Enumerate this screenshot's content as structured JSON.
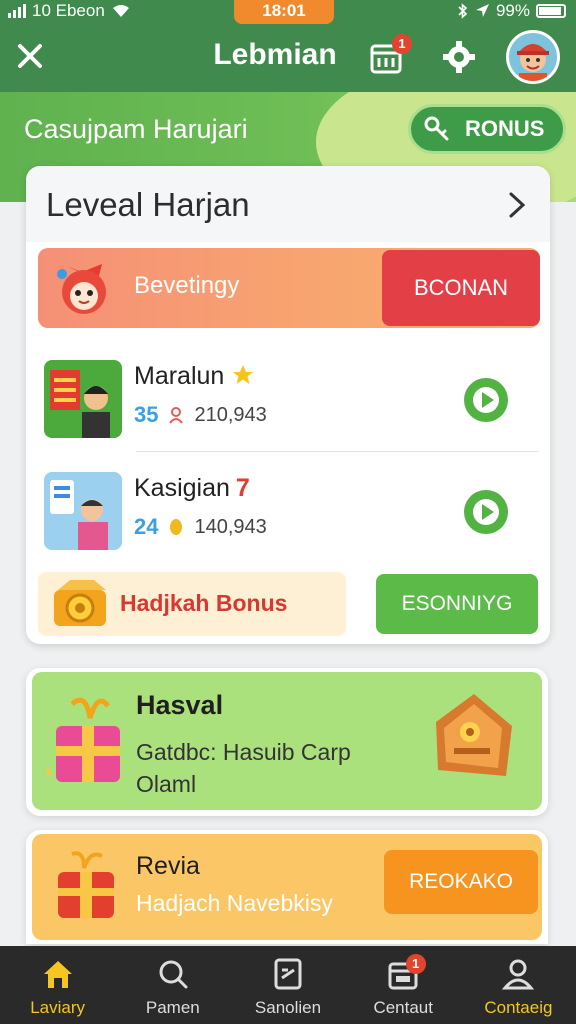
{
  "status": {
    "carrier": "10 Ebeon",
    "time": "18:01",
    "battery": "99%"
  },
  "app_bar": {
    "title": "Lebmian",
    "calendar_badge": "1"
  },
  "banner": {
    "title": "Casujpam Harujari",
    "bonus_label": "RONUS"
  },
  "main_card": {
    "title": "Leveal Harjan",
    "promo": {
      "label": "Bevetingy",
      "button": "BCONAN"
    },
    "games": [
      {
        "name": "Maralun",
        "count": "35",
        "players": "210,943"
      },
      {
        "name": "Kasigian",
        "mark": "7",
        "count": "24",
        "players": "140,943"
      }
    ],
    "bonus": {
      "label": "Hadjkah Bonus",
      "button": "ESONNIYG"
    }
  },
  "green_card": {
    "title": "Hasval",
    "description": "Gatdbc: Hasuib Carp Olaml"
  },
  "yellow_card": {
    "title": "Revia",
    "description": "Hadjach Navebkisy",
    "button": "REOKAKO"
  },
  "bottom_nav": {
    "items": [
      {
        "label": "Laviary"
      },
      {
        "label": "Pamen"
      },
      {
        "label": "Sanolien"
      },
      {
        "label": "Centaut",
        "badge": "1"
      },
      {
        "label": "Contaeig"
      }
    ]
  },
  "colors": {
    "primary_green": "#3f8a4c",
    "accent_orange": "#f7931f",
    "promo_red": "#e33f47",
    "nav_active": "#f4c61f"
  }
}
